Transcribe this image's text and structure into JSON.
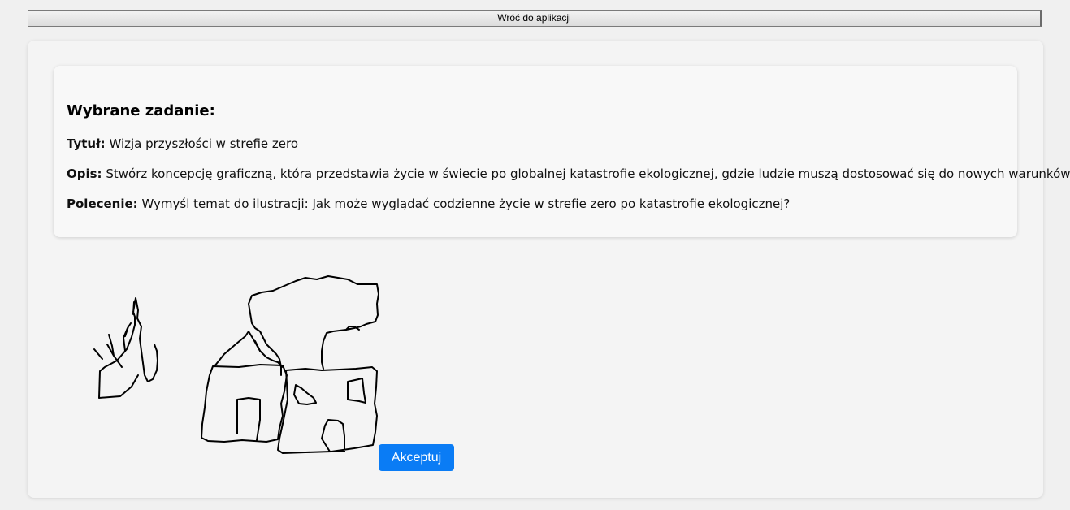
{
  "back_button": {
    "label": "Wróć do aplikacji"
  },
  "task": {
    "heading": "Wybrane zadanie:",
    "title_label": "Tytuł:",
    "title_value": "Wizja przyszłości w strefie zero",
    "description_label": "Opis:",
    "description_value": "Stwórz koncepcję graficzną, która przedstawia życie w świecie po globalnej katastrofie ekologicznej, gdzie ludzie muszą dostosować się do nowych warunków.",
    "command_label": "Polecenie:",
    "command_value": "Wymyśl temat do ilustracji: Jak może wyglądać codzienne życie w strefie zero po katastrofie ekologicznej?"
  },
  "drawing": {
    "stroke_color": "#000000"
  },
  "accept_button": {
    "label": "Akceptuj",
    "color": "#0a7cf5"
  }
}
